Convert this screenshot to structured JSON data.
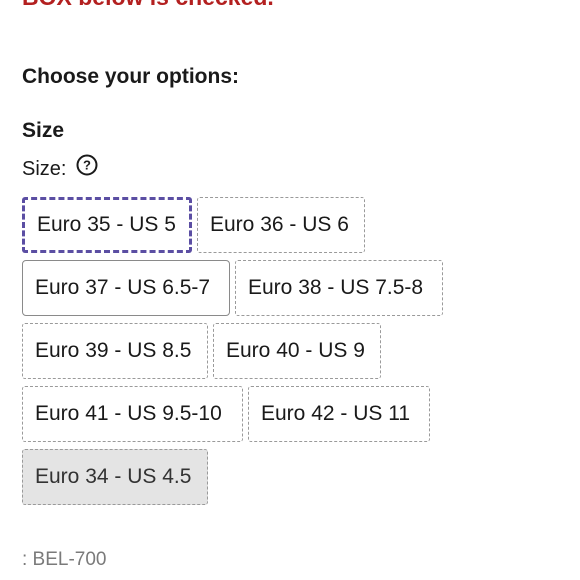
{
  "warning_text": "BOX below is checked.",
  "options_title": "Choose your options:",
  "size_section": {
    "heading": "Size",
    "label": "Size:",
    "help_icon": "question-circle-icon",
    "options": [
      {
        "label": "Euro 35 - US 5",
        "state": "focused"
      },
      {
        "label": "Euro 36 - US 6",
        "state": "default"
      },
      {
        "label": "Euro 37 - US 6.5-7",
        "state": "selected"
      },
      {
        "label": "Euro 38 - US 7.5-8",
        "state": "default"
      },
      {
        "label": "Euro 39 - US 8.5",
        "state": "default"
      },
      {
        "label": "Euro 40 - US 9",
        "state": "default"
      },
      {
        "label": "Euro 41 - US 9.5-10",
        "state": "default"
      },
      {
        "label": "Euro 42 - US 11",
        "state": "default"
      },
      {
        "label": "Euro 34 - US 4.5",
        "state": "disabled"
      }
    ]
  },
  "sku_text": ": BEL-700",
  "colors": {
    "warning": "#b32020",
    "focus_outline": "#5b4ea3",
    "disabled_bg": "#e4e4e4",
    "sku_text": "#7a7a7a"
  }
}
